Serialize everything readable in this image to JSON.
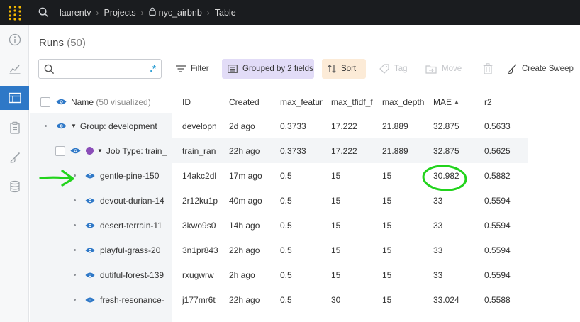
{
  "topbar": {
    "breadcrumbs": [
      "laurentv",
      "Projects",
      "nyc_airbnb",
      "Table"
    ]
  },
  "rail": {
    "items": [
      "info-icon",
      "chart-icon",
      "table-icon",
      "clipboard-icon",
      "brush-icon",
      "database-icon"
    ],
    "active": "table-icon"
  },
  "runs": {
    "title": "Runs",
    "count": "(50)"
  },
  "toolbar": {
    "search_placeholder": "",
    "regex_label": ".*",
    "filter": "Filter",
    "grouped": "Grouped by 2 fields",
    "sort": "Sort",
    "tag": "Tag",
    "move": "Move",
    "create_sweep": "Create Sweep"
  },
  "table": {
    "name_header": "Name",
    "name_header_sub": "(50 visualized)",
    "columns": [
      "ID",
      "Created",
      "max_featur",
      "max_tfidf_f",
      "max_depth",
      "MAE",
      "r2"
    ],
    "sorted_column": "MAE",
    "group_row": {
      "name": "Group: development",
      "cells": [
        "developn",
        "2d ago",
        "0.3733",
        "17.222",
        "21.889",
        "32.875",
        "0.5633"
      ]
    },
    "job_row": {
      "name": "Job Type: train_",
      "cells": [
        "train_ran",
        "22h ago",
        "0.3733",
        "17.222",
        "21.889",
        "32.875",
        "0.5625"
      ]
    },
    "runs": [
      {
        "name": "gentle-pine-150",
        "cells": [
          "14akc2dl",
          "17m ago",
          "0.5",
          "15",
          "15",
          "30.982",
          "0.5882"
        ]
      },
      {
        "name": "devout-durian-14",
        "cells": [
          "2r12ku1p",
          "40m ago",
          "0.5",
          "15",
          "15",
          "33",
          "0.5594"
        ]
      },
      {
        "name": "desert-terrain-11",
        "cells": [
          "3kwo9s0",
          "14h ago",
          "0.5",
          "15",
          "15",
          "33",
          "0.5594"
        ]
      },
      {
        "name": "playful-grass-20",
        "cells": [
          "3n1pr843",
          "22h ago",
          "0.5",
          "15",
          "15",
          "33",
          "0.5594"
        ]
      },
      {
        "name": "dutiful-forest-139",
        "cells": [
          "rxugwrw",
          "2h ago",
          "0.5",
          "15",
          "15",
          "33",
          "0.5594"
        ]
      },
      {
        "name": "fresh-resonance-",
        "cells": [
          "j177mr6t",
          "22h ago",
          "0.5",
          "30",
          "15",
          "33.024",
          "0.5588"
        ]
      }
    ]
  },
  "colors": {
    "accent": "#2e78c7",
    "annotation": "#22d31c",
    "group_color": "#8a4db8"
  }
}
